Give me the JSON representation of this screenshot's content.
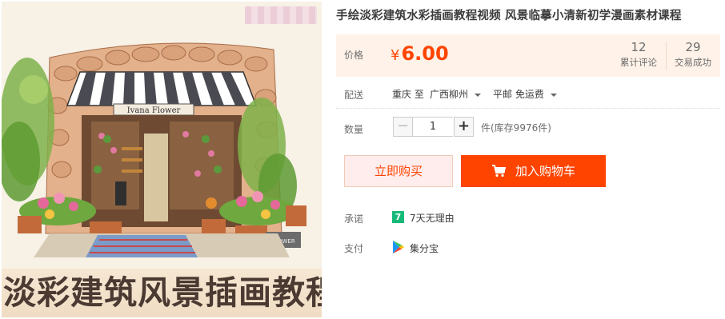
{
  "product_image": {
    "caption": "淡彩建筑风景插画教程",
    "sign_text": "Ivana Flower",
    "box_text": "FLOWER"
  },
  "title": "手绘淡彩建筑水彩插画教程视频 风景临摹小清新初学漫画素材课程",
  "price": {
    "label": "价格",
    "currency": "¥",
    "value": "6.00",
    "accent_color": "#ff4400"
  },
  "stats": [
    {
      "value": "12",
      "label": "累计评论"
    },
    {
      "value": "29",
      "label": "交易成功"
    }
  ],
  "shipping": {
    "label": "配送",
    "from": "重庆 至",
    "to": "广西柳州",
    "method": "平邮 免运费"
  },
  "quantity": {
    "label": "数量",
    "minus": "−",
    "value": "1",
    "plus": "+",
    "stock": "件(库存9976件)"
  },
  "actions": {
    "buy_now": "立即购买",
    "add_to_cart": "加入购物车"
  },
  "promise": {
    "label": "承诺",
    "icon_text": "7",
    "text": "7天无理由"
  },
  "payment": {
    "label": "支付",
    "icon": "google-play-like-icon",
    "text": "集分宝"
  }
}
